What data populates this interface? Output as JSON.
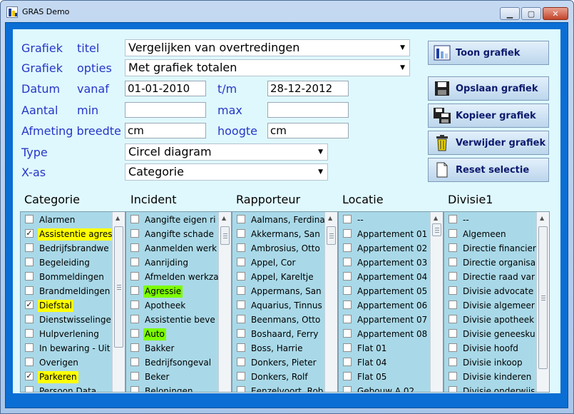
{
  "window": {
    "title": "GRAS Demo",
    "min_label": "▁",
    "max_label": "▢",
    "close_label": "✕"
  },
  "form": {
    "grafiek_label": "Grafiek",
    "titel_label": "titel",
    "titel_value": "Vergelijken van overtredingen",
    "opties_label": "opties",
    "opties_value": "Met grafiek totalen",
    "datum_label": "Datum",
    "vanaf_label": "vanaf",
    "vanaf_value": "01-01-2010",
    "tm_label": "t/m",
    "tm_value": "28-12-2012",
    "aantal_label": "Aantal",
    "min_label": "min",
    "min_value": "",
    "max_label": "max",
    "max_value": "",
    "afmeting_label": "Afmeting breedte",
    "breedte_value": "cm",
    "hoogte_label": "hoogte",
    "hoogte_value": "cm",
    "type_label": "Type",
    "type_value": "Circel diagram",
    "xas_label": "X-as",
    "xas_value": "Categorie"
  },
  "buttons": {
    "toon": "Toon grafiek",
    "opslaan": "Opslaan grafiek",
    "kopieer": "Kopieer grafiek",
    "verwijder": "Verwijder grafiek",
    "reset": "Reset selectie"
  },
  "columns": {
    "categorie": {
      "header": "Categorie",
      "items": [
        {
          "label": "Alarmen",
          "checked": false,
          "highlight": ""
        },
        {
          "label": "Assistentie agres",
          "checked": true,
          "highlight": "#ffff00"
        },
        {
          "label": "Bedrijfsbrandwe",
          "checked": false,
          "highlight": ""
        },
        {
          "label": "Begeleiding",
          "checked": false,
          "highlight": ""
        },
        {
          "label": "Bommeldingen",
          "checked": false,
          "highlight": ""
        },
        {
          "label": "Brandmeldingen",
          "checked": false,
          "highlight": ""
        },
        {
          "label": "Diefstal",
          "checked": true,
          "highlight": "#ffff00"
        },
        {
          "label": "Dienstwisselinge",
          "checked": false,
          "highlight": ""
        },
        {
          "label": "Hulpverlening",
          "checked": false,
          "highlight": ""
        },
        {
          "label": "In bewaring - Uit",
          "checked": false,
          "highlight": ""
        },
        {
          "label": "Overigen",
          "checked": false,
          "highlight": ""
        },
        {
          "label": "Parkeren",
          "checked": true,
          "highlight": "#ffff00"
        },
        {
          "label": "Persoon Data",
          "checked": false,
          "highlight": ""
        }
      ]
    },
    "incident": {
      "header": "Incident",
      "items": [
        {
          "label": "Aangifte eigen ri",
          "checked": false,
          "highlight": ""
        },
        {
          "label": "Aangifte schade",
          "checked": false,
          "highlight": ""
        },
        {
          "label": "Aanmelden werk",
          "checked": false,
          "highlight": ""
        },
        {
          "label": "Aanrijding",
          "checked": false,
          "highlight": ""
        },
        {
          "label": "Afmelden werkza",
          "checked": false,
          "highlight": ""
        },
        {
          "label": "Agressie",
          "checked": false,
          "highlight": "#7cfc00"
        },
        {
          "label": "Apotheek",
          "checked": false,
          "highlight": ""
        },
        {
          "label": "Assistentie beve",
          "checked": false,
          "highlight": ""
        },
        {
          "label": "Auto",
          "checked": false,
          "highlight": "#7cfc00"
        },
        {
          "label": "Bakker",
          "checked": false,
          "highlight": ""
        },
        {
          "label": "Bedrijfsongeval",
          "checked": false,
          "highlight": ""
        },
        {
          "label": "Beker",
          "checked": false,
          "highlight": ""
        },
        {
          "label": "Beloningen",
          "checked": false,
          "highlight": ""
        }
      ]
    },
    "rapporteur": {
      "header": "Rapporteur",
      "items": [
        {
          "label": "Aalmans, Ferdina",
          "checked": false,
          "highlight": ""
        },
        {
          "label": "Akkermans, San",
          "checked": false,
          "highlight": ""
        },
        {
          "label": "Ambrosius, Otto",
          "checked": false,
          "highlight": ""
        },
        {
          "label": "Appel, Cor",
          "checked": false,
          "highlight": ""
        },
        {
          "label": "Appel, Kareltje",
          "checked": false,
          "highlight": ""
        },
        {
          "label": "Appermans, San",
          "checked": false,
          "highlight": ""
        },
        {
          "label": "Aquarius, Tinnus",
          "checked": false,
          "highlight": ""
        },
        {
          "label": "Beenmans, Otto",
          "checked": false,
          "highlight": ""
        },
        {
          "label": "Boshaard, Ferry",
          "checked": false,
          "highlight": ""
        },
        {
          "label": "Boss, Harrie",
          "checked": false,
          "highlight": ""
        },
        {
          "label": "Donkers, Pieter",
          "checked": false,
          "highlight": ""
        },
        {
          "label": "Donkers, Rolf",
          "checked": false,
          "highlight": ""
        },
        {
          "label": "Eenzelvoort, Rob",
          "checked": false,
          "highlight": ""
        }
      ]
    },
    "locatie": {
      "header": "Locatie",
      "items": [
        {
          "label": "--",
          "checked": false,
          "highlight": ""
        },
        {
          "label": "Appartement 01",
          "checked": false,
          "highlight": ""
        },
        {
          "label": "Appartement 02",
          "checked": false,
          "highlight": ""
        },
        {
          "label": "Appartement 03",
          "checked": false,
          "highlight": ""
        },
        {
          "label": "Appartement 04",
          "checked": false,
          "highlight": ""
        },
        {
          "label": "Appartement 05",
          "checked": false,
          "highlight": ""
        },
        {
          "label": "Appartement 06",
          "checked": false,
          "highlight": ""
        },
        {
          "label": "Appartement 07",
          "checked": false,
          "highlight": ""
        },
        {
          "label": "Appartement 08",
          "checked": false,
          "highlight": ""
        },
        {
          "label": "Flat 01",
          "checked": false,
          "highlight": ""
        },
        {
          "label": "Flat 04",
          "checked": false,
          "highlight": ""
        },
        {
          "label": "Flat 05",
          "checked": false,
          "highlight": ""
        },
        {
          "label": "Gebouw A 02",
          "checked": false,
          "highlight": ""
        }
      ]
    },
    "divisie": {
      "header": "Divisie1",
      "items": [
        {
          "label": "--",
          "checked": false,
          "highlight": ""
        },
        {
          "label": "Algemeen",
          "checked": false,
          "highlight": ""
        },
        {
          "label": "Directie financier",
          "checked": false,
          "highlight": ""
        },
        {
          "label": "Directie organisa",
          "checked": false,
          "highlight": ""
        },
        {
          "label": "Directie raad var",
          "checked": false,
          "highlight": ""
        },
        {
          "label": "Divisie advocate",
          "checked": false,
          "highlight": ""
        },
        {
          "label": "Divisie algemeer",
          "checked": false,
          "highlight": ""
        },
        {
          "label": "Divisie apotheek",
          "checked": false,
          "highlight": ""
        },
        {
          "label": "Divisie geneesku",
          "checked": false,
          "highlight": ""
        },
        {
          "label": "Divisie hoofd",
          "checked": false,
          "highlight": ""
        },
        {
          "label": "Divisie inkoop",
          "checked": false,
          "highlight": ""
        },
        {
          "label": "Divisie kinderen",
          "checked": false,
          "highlight": ""
        },
        {
          "label": "Divisie onderwijs",
          "checked": false,
          "highlight": ""
        }
      ]
    }
  }
}
